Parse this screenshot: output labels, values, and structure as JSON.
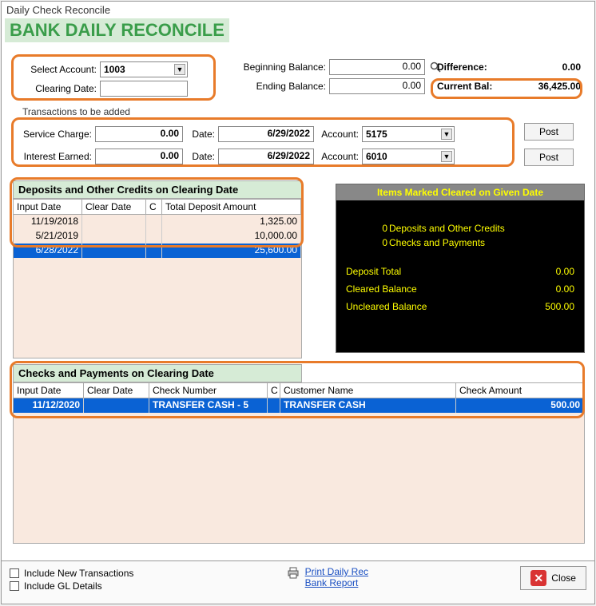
{
  "window": {
    "title": "Daily Check Reconcile"
  },
  "heading": "BANK DAILY RECONCILE",
  "account": {
    "select_label": "Select Account:",
    "select_value": "1003",
    "clearing_label": "Clearing Date:",
    "clearing_value": ""
  },
  "balances": {
    "begin_label": "Beginning Balance:",
    "begin_value": "0.00",
    "end_label": "Ending Balance:",
    "end_value": "0.00"
  },
  "diff": {
    "diff_label": "Difference:",
    "diff_value": "0.00",
    "cur_label": "Current Bal:",
    "cur_value": "36,425.00"
  },
  "trans_fieldset_label": "Transactions to be added",
  "trans": {
    "sc_label": "Service Charge:",
    "sc_value": "0.00",
    "sc_date_label": "Date:",
    "sc_date": "6/29/2022",
    "sc_acct_label": "Account:",
    "sc_acct": "5175",
    "ie_label": "Interest Earned:",
    "ie_value": "0.00",
    "ie_date_label": "Date:",
    "ie_date": "6/29/2022",
    "ie_acct_label": "Account:",
    "ie_acct": "6010",
    "post": "Post"
  },
  "deposits": {
    "header": "Deposits and Other Credits on Clearing Date",
    "cols": {
      "input": "Input Date",
      "clear": "Clear Date",
      "c": "C",
      "amount": "Total Deposit Amount"
    },
    "rows": [
      {
        "input": "11/19/2018",
        "clear": "",
        "c": "",
        "amount": "1,325.00"
      },
      {
        "input": "5/21/2019",
        "clear": "",
        "c": "",
        "amount": "10,000.00"
      },
      {
        "input": "6/28/2022",
        "clear": "",
        "c": "",
        "amount": "25,600.00"
      }
    ]
  },
  "marked": {
    "title": "Items Marked Cleared on Given Date",
    "dep_count": "0",
    "dep_label": "Deposits and Other Credits",
    "chk_count": "0",
    "chk_label": "Checks and Payments",
    "dep_total_label": "Deposit Total",
    "dep_total": "0.00",
    "cleared_label": "Cleared Balance",
    "cleared": "0.00",
    "uncleared_label": "Uncleared Balance",
    "uncleared": "500.00"
  },
  "checks": {
    "header": "Checks and Payments on Clearing Date",
    "cols": {
      "input": "Input Date",
      "clear": "Clear Date",
      "chk": "Check Number",
      "c": "C",
      "cust": "Customer Name",
      "amt": "Check Amount"
    },
    "rows": [
      {
        "input": "11/12/2020",
        "clear": "",
        "chk": "TRANSFER CASH - 5",
        "c": "",
        "cust": "TRANSFER CASH",
        "amt": "500.00"
      }
    ]
  },
  "footer": {
    "include_new": "Include New Transactions",
    "include_gl": "Include GL Details",
    "print_line1": "Print Daily Rec",
    "print_line2": "Bank Report",
    "close": "Close"
  }
}
